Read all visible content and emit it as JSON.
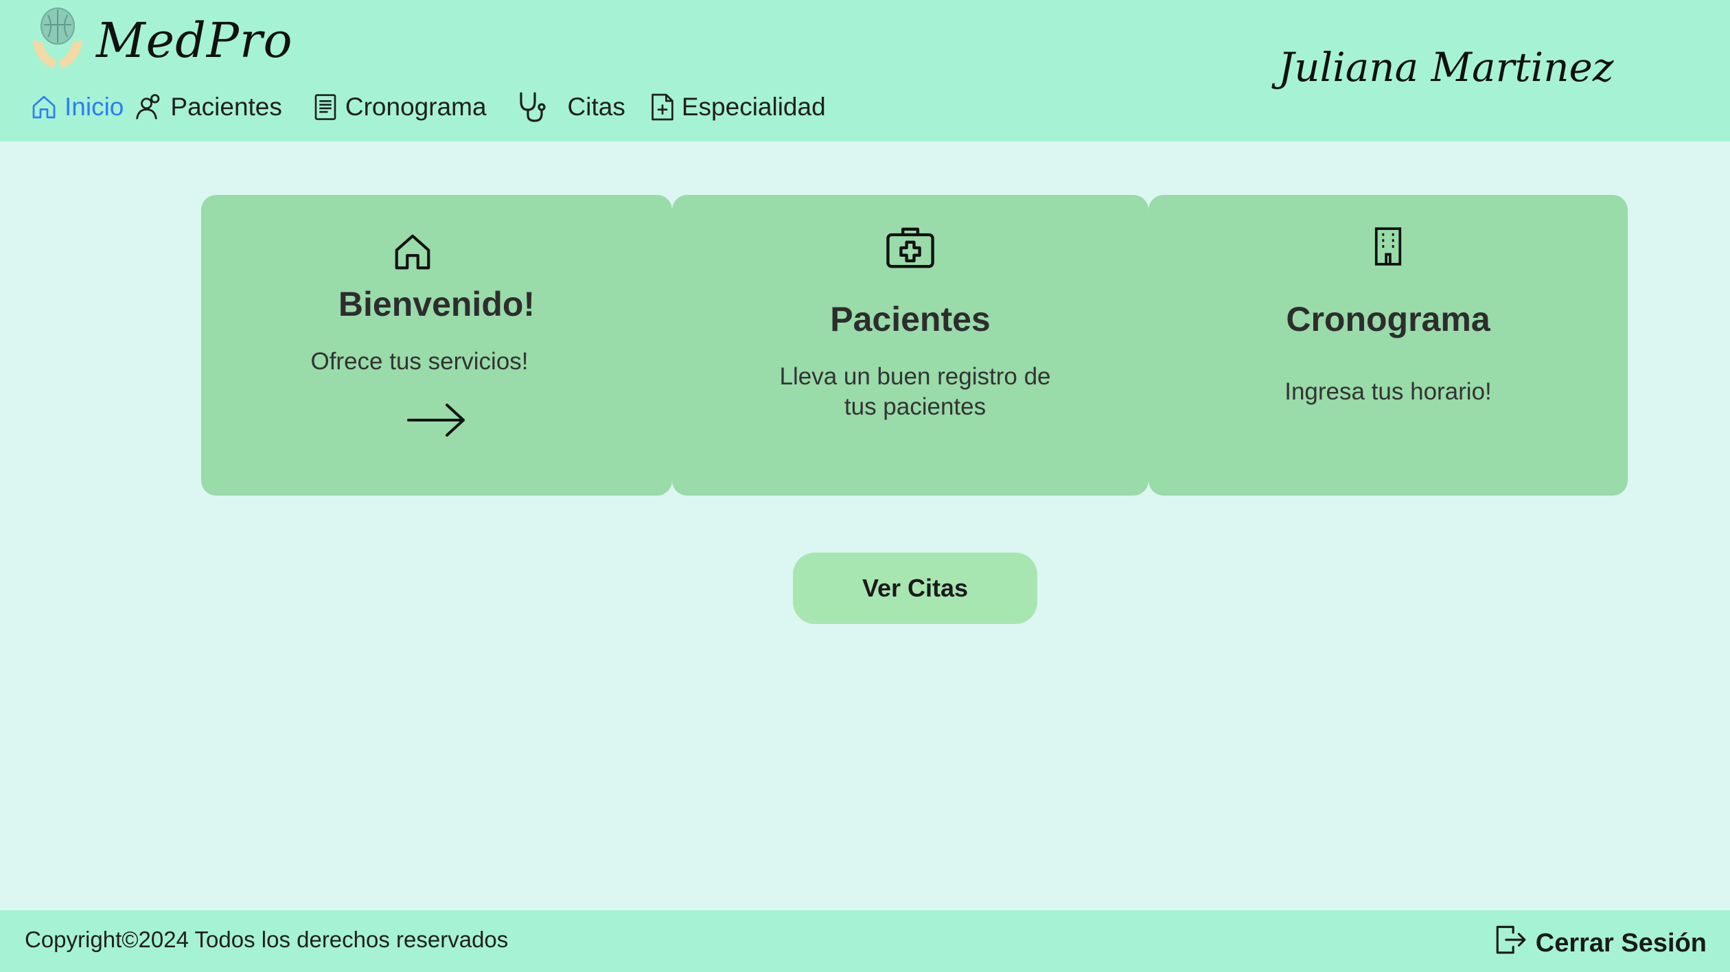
{
  "header": {
    "brand": "MedPro",
    "user_name": "Juliana Martinez",
    "logo_icon": "brain-hands-logo"
  },
  "nav": {
    "items": [
      {
        "label": "Inicio",
        "icon": "home-icon",
        "active": true
      },
      {
        "label": "Pacientes",
        "icon": "user-icon",
        "active": false
      },
      {
        "label": "Cronograma",
        "icon": "document-icon",
        "active": false
      },
      {
        "label": "Citas",
        "icon": "stethoscope-icon",
        "active": false
      },
      {
        "label": "Especialidad",
        "icon": "file-plus-icon",
        "active": false
      }
    ]
  },
  "cards": [
    {
      "title": "Bienvenido!",
      "text": "Ofrece tus servicios!",
      "icon": "home-icon",
      "extra_icon": "arrow-right-icon"
    },
    {
      "title": "Pacientes",
      "text_line1": "Lleva un buen registro de",
      "text_line2": "tus pacientes",
      "icon": "medkit-icon"
    },
    {
      "title": "Cronograma",
      "text": "Ingresa tus horario!",
      "icon": "building-icon"
    }
  ],
  "main": {
    "ver_citas_label": "Ver Citas"
  },
  "footer": {
    "copyright": "Copyright©2024 Todos los derechos reservados",
    "logout_label": "Cerrar Sesión",
    "logout_icon": "logout-icon"
  },
  "colors": {
    "header_bg": "#a5f3d4",
    "page_bg": "#dcf6f1",
    "card_bg": "#99dba9",
    "button_bg": "#a8e6b1",
    "active_nav": "#2e7cf6"
  }
}
